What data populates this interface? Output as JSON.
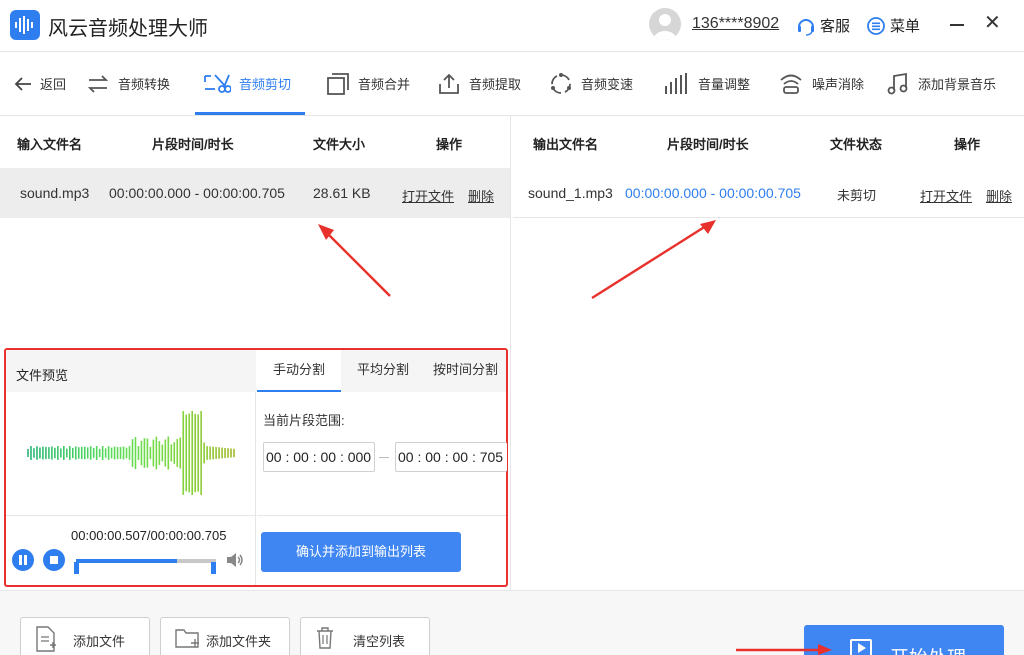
{
  "app": {
    "title": "风云音频处理大师"
  },
  "header": {
    "user": "136****8902",
    "service": "客服",
    "menu": "菜单"
  },
  "toolbar": {
    "back": "返回",
    "tools": [
      "音频转换",
      "音频剪切",
      "音频合并",
      "音频提取",
      "音频变速",
      "音量调整",
      "噪声消除",
      "添加背景音乐"
    ],
    "active": "音频剪切"
  },
  "input_table": {
    "headers": [
      "输入文件名",
      "片段时间/时长",
      "文件大小",
      "操作"
    ],
    "rows": [
      {
        "name": "sound.mp3",
        "time": "00:00:00.000 - 00:00:00.705",
        "size": "28.61 KB",
        "open": "打开文件",
        "delete": "删除"
      }
    ]
  },
  "output_table": {
    "headers": [
      "输出文件名",
      "片段时间/时长",
      "文件状态",
      "操作"
    ],
    "rows": [
      {
        "name": "sound_1.mp3",
        "time": "00:00:00.000 - 00:00:00.705",
        "status": "未剪切",
        "open": "打开文件",
        "delete": "删除"
      }
    ]
  },
  "preview": {
    "title": "文件预览",
    "time": "00:00:00.507/00:00:00.705",
    "progress": 0.72
  },
  "split": {
    "tabs": [
      "手动分割",
      "平均分割",
      "按时间分割"
    ],
    "active_tab": "手动分割",
    "range_label": "当前片段范围:",
    "start": "00 : 00 : 00 : 000",
    "end": "00 : 00 : 00 : 705",
    "confirm": "确认并添加到输出列表"
  },
  "bottom": {
    "add_file": "添加文件",
    "add_folder": "添加文件夹",
    "clear": "清空列表",
    "start": "开始处理"
  },
  "colors": {
    "accent": "#2f7ef0",
    "annotation": "#e8312c"
  }
}
